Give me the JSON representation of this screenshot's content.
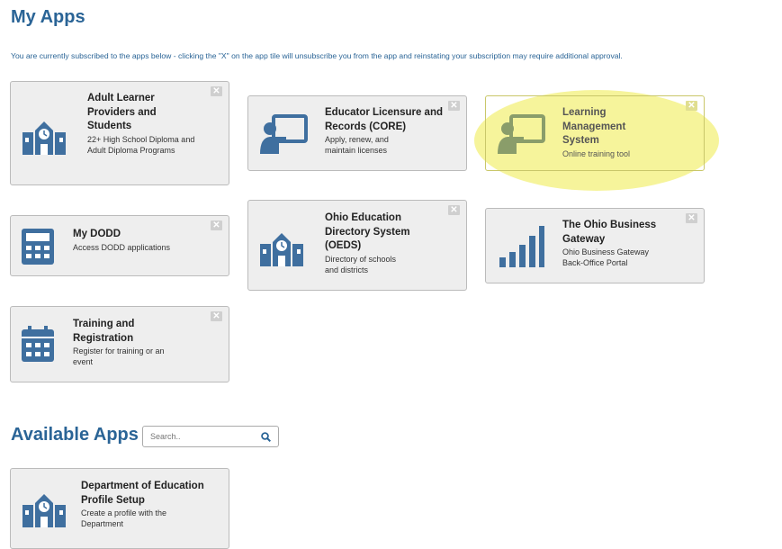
{
  "my_apps": {
    "title": "My Apps",
    "notice": "You are currently subscribed to the apps below - clicking the \"X\" on the app tile will unsubscribe you from the app and reinstating your subscription may require additional approval.",
    "tiles": [
      {
        "title": "Adult Learner Providers and Students",
        "desc": "22+ High School Diploma and Adult Diploma Programs",
        "icon": "school-building-icon",
        "close": "✕"
      },
      {
        "title": "Educator Licensure and Records (CORE)",
        "desc": "Apply, renew, and maintain licenses",
        "icon": "teacher-board-icon",
        "close": "✕"
      },
      {
        "title": "Learning Management System",
        "desc": "Online training tool",
        "icon": "teacher-board-icon",
        "close": "✕"
      },
      {
        "title": "My DODD",
        "desc": "Access DODD applications",
        "icon": "calculator-icon",
        "close": "✕"
      },
      {
        "title": "Ohio Education Directory System (OEDS)",
        "desc": "Directory of schools and districts",
        "icon": "school-building-icon",
        "close": "✕"
      },
      {
        "title": "The Ohio Business Gateway",
        "desc": "Ohio Business Gateway Back-Office Portal",
        "icon": "bar-signal-icon",
        "close": "✕"
      },
      {
        "title": "Training and Registration",
        "desc": "Register for training or an event",
        "icon": "calendar-icon",
        "close": "✕"
      }
    ]
  },
  "available_apps": {
    "title": "Available Apps",
    "search": {
      "placeholder": "Search..",
      "icon": "search-icon"
    },
    "tiles": [
      {
        "title": "Department of Education Profile Setup",
        "desc": "Create a profile with the Department",
        "icon": "school-building-icon"
      }
    ]
  },
  "colors": {
    "accent": "#2a6496",
    "icon": "#3f6f9f",
    "highlight": "#f4f28a"
  }
}
